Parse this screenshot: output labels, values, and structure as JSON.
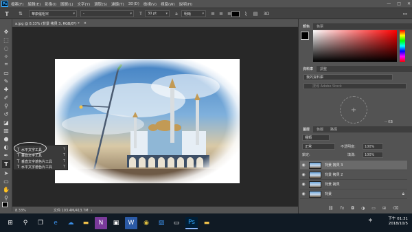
{
  "menu": {
    "app_icon": "Ps",
    "items": [
      "檔案(F)",
      "編輯(E)",
      "影像(I)",
      "圖層(L)",
      "文字(Y)",
      "選取(S)",
      "濾鏡(T)",
      "3D(D)",
      "檢視(V)",
      "視窗(W)",
      "說明(H)"
    ],
    "window_controls": [
      "—",
      "□",
      "✕"
    ]
  },
  "options": {
    "font_family": "華康儷粗宋",
    "font_style": "-",
    "font_size": "30 pt",
    "antialias": "明晰",
    "align_left_icon": "align-left-icon",
    "ok_icon": "checkmark-icon"
  },
  "document": {
    "tab_title": "a.jpg @ 8.33% (背景 拷貝 3, RGB/8*) *",
    "close_icon": "×"
  },
  "status": {
    "zoom": "8.33%",
    "doc_info": "文件:103.4M/413.7M"
  },
  "toolbar_flyout": {
    "items": [
      {
        "label": "水平文字工具",
        "key": "T",
        "glyph": "T"
      },
      {
        "label": "垂直文字工具",
        "key": "T",
        "glyph": "T"
      },
      {
        "label": "垂直文字遮色片工具",
        "key": "T",
        "glyph": "T"
      },
      {
        "label": "水平文字遮色片工具",
        "key": "T",
        "glyph": "T"
      }
    ]
  },
  "panels": {
    "color_tabs": [
      "顏色",
      "色票"
    ],
    "library_tabs": [
      "資料庫",
      "調整"
    ],
    "library_select": "我的資料庫",
    "library_search_placeholder": "搜尋 Adobe Stock",
    "library_size": "-- KB",
    "layers_tabs": [
      "圖層",
      "色版",
      "路徑"
    ],
    "layer_filter": "種類",
    "blend_mode": "正常",
    "opacity_label": "不透明度:",
    "opacity_value": "100%",
    "lock_label": "鎖定:",
    "fill_label": "填滿:",
    "fill_value": "100%",
    "layers": [
      {
        "name": "背景 拷貝 3",
        "selected": true,
        "locked": false
      },
      {
        "name": "背景 拷貝 2",
        "selected": false,
        "locked": false
      },
      {
        "name": "背景 拷貝",
        "selected": false,
        "locked": false
      },
      {
        "name": "背景",
        "selected": false,
        "locked": true
      }
    ]
  },
  "taskbar": {
    "time": "下午 01:31",
    "date": "2018/10/5",
    "ime": "中",
    "icons": [
      "windows-start-icon",
      "search-icon",
      "task-view-icon",
      "edge-icon",
      "onedrive-icon",
      "explorer-icon",
      "onenote-icon",
      "store-icon",
      "word-icon",
      "chrome-icon",
      "photos-icon",
      "folder-icon",
      "photoshop-icon",
      "explorer2-icon"
    ]
  },
  "colors": {
    "chrome_bg": "#535353",
    "canvas_bg": "#282828",
    "accent_blue": "#31a8ff",
    "taskbar": "#101a24"
  }
}
